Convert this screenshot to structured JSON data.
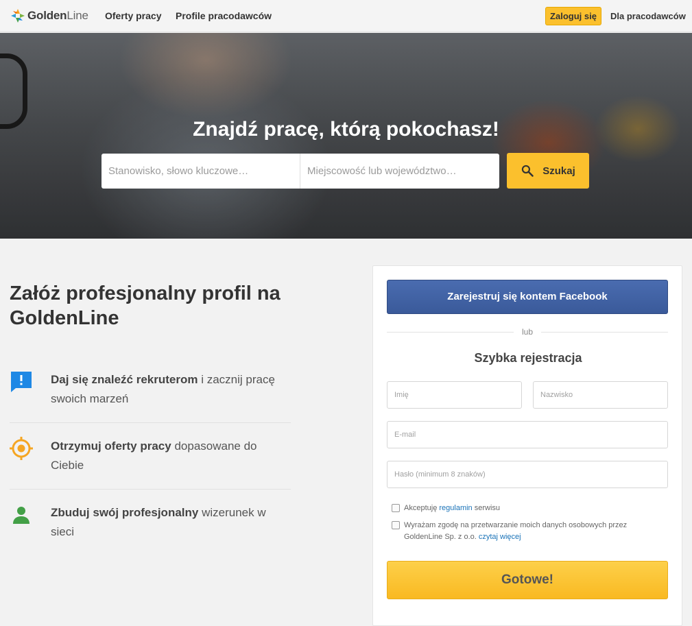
{
  "header": {
    "logo_bold": "Golden",
    "logo_light": "Line",
    "nav": [
      "Oferty pracy",
      "Profile pracodawców"
    ],
    "login_label": "Zaloguj się",
    "employers_label": "Dla pracodawców"
  },
  "hero": {
    "title": "Znajdź pracę, którą pokochasz!",
    "job_placeholder": "Stanowisko, słowo kluczowe…",
    "location_placeholder": "Miejscowość lub województwo…",
    "search_label": "Szukaj"
  },
  "benefits_section": {
    "title": "Załóż profesjonalny profil na GoldenLine",
    "items": [
      {
        "icon": "message-alert-icon",
        "bold": "Daj się znaleźć rekruterom",
        "rest": " i zacznij pracę swoich marzeń"
      },
      {
        "icon": "target-icon",
        "bold": "Otrzymuj oferty pracy",
        "rest": " dopasowane do Ciebie"
      },
      {
        "icon": "person-icon",
        "bold": "Zbuduj swój profesjonalny",
        "rest": " wizerunek w sieci"
      }
    ]
  },
  "register": {
    "facebook_label": "Zarejestruj się kontem Facebook",
    "or_label": "lub",
    "title": "Szybka rejestracja",
    "first_name_placeholder": "Imię",
    "last_name_placeholder": "Nazwisko",
    "email_placeholder": "E-mail",
    "password_placeholder": "Hasło (minimum 8 znaków)",
    "terms_pre": "Akceptuję ",
    "terms_link": "regulamin",
    "terms_post": " serwisu",
    "consent_text": "Wyrażam zgodę na przetwarzanie moich danych osobowych przez GoldenLine Sp. z o.o. ",
    "consent_link": "czytaj więcej",
    "submit_label": "Gotowe!"
  },
  "colors": {
    "accent": "#fbc02d",
    "facebook": "#3b5998",
    "icon_blue": "#1e88e5",
    "icon_orange": "#f5a623",
    "icon_green": "#43a047",
    "link": "#1a73b8"
  }
}
